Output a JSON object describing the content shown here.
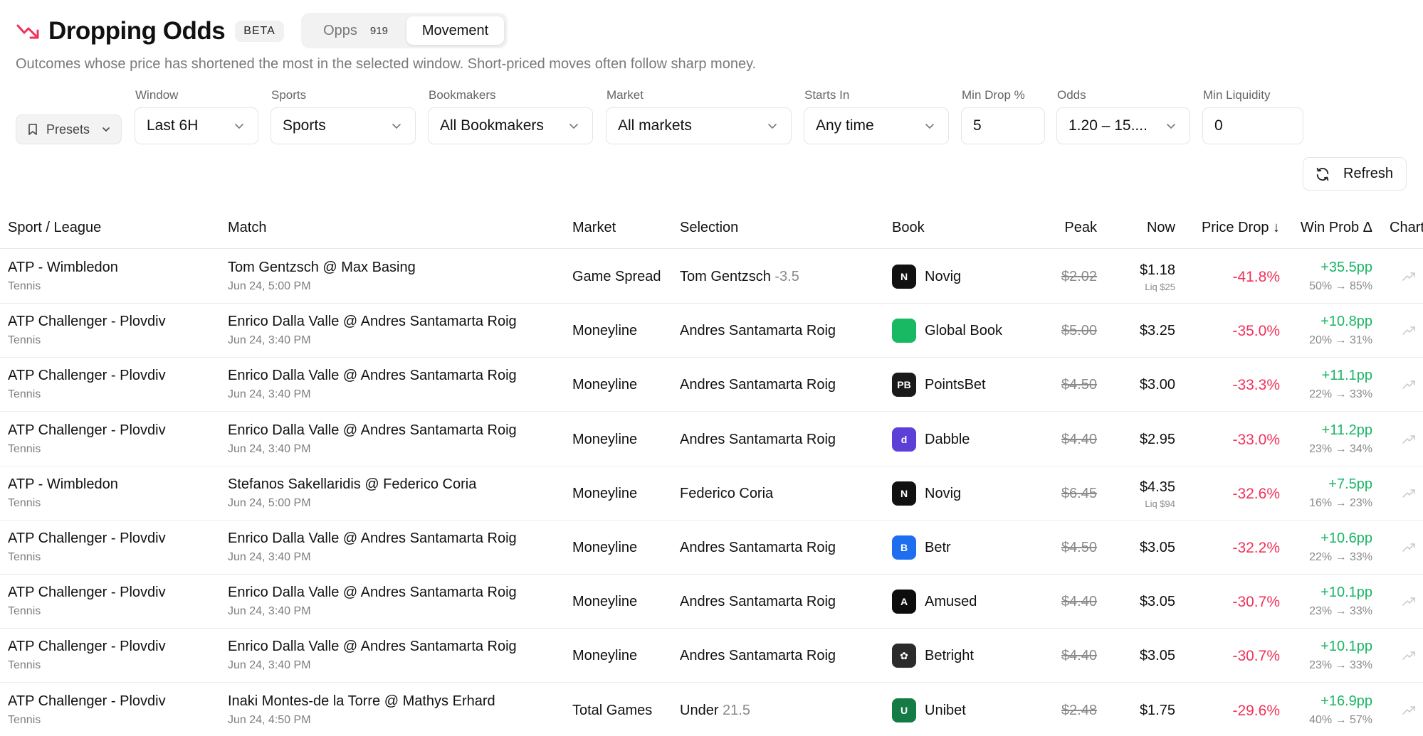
{
  "header": {
    "title": "Dropping Odds",
    "badge": "BETA",
    "subtitle": "Outcomes whose price has shortened the most in the selected window. Short-priced moves often follow sharp money."
  },
  "view_tabs": {
    "opps_label": "Opps",
    "opps_count": "919",
    "movement_label": "Movement",
    "active": "Movement"
  },
  "filters": {
    "presets_label": "Presets",
    "window": {
      "label": "Window",
      "value": "Last 6H"
    },
    "sports": {
      "label": "Sports",
      "value": "Sports"
    },
    "bookmakers": {
      "label": "Bookmakers",
      "value": "All Bookmakers"
    },
    "market": {
      "label": "Market",
      "value": "All markets"
    },
    "starts_in": {
      "label": "Starts In",
      "value": "Any time"
    },
    "min_drop": {
      "label": "Min Drop %",
      "value": "5"
    },
    "odds": {
      "label": "Odds",
      "value": "1.20 – 15...."
    },
    "min_liquidity": {
      "label": "Min Liquidity",
      "value": "0"
    }
  },
  "refresh_label": "Refresh",
  "table": {
    "columns": {
      "sport_league": "Sport / League",
      "match": "Match",
      "market": "Market",
      "selection": "Selection",
      "book": "Book",
      "peak": "Peak",
      "now": "Now",
      "price_drop": "Price Drop ↓",
      "win_prob": "Win Prob Δ",
      "chart": "Chart"
    },
    "rows": [
      {
        "league": "ATP - Wimbledon",
        "sport": "Tennis",
        "match": "Tom Gentzsch @ Max Basing",
        "time": "Jun 24, 5:00 PM",
        "market": "Game Spread",
        "selection": "Tom Gentzsch",
        "selection_line": "-3.5",
        "book": "Novig",
        "book_icon": "novig-logo",
        "book_color": "#111111",
        "peak": "$2.02",
        "now": "$1.18",
        "liq": "Liq $25",
        "drop": "-41.8%",
        "prob": "+35.5pp",
        "prob_range": "50% → 85%"
      },
      {
        "league": "ATP Challenger - Plovdiv",
        "sport": "Tennis",
        "match": "Enrico Dalla Valle @ Andres Santamarta Roig",
        "time": "Jun 24, 3:40 PM",
        "market": "Moneyline",
        "selection": "Andres Santamarta Roig",
        "selection_line": "",
        "book": "Global Book",
        "book_icon": "global-book-logo",
        "book_color": "#19b863",
        "peak": "$5.00",
        "now": "$3.25",
        "liq": "",
        "drop": "-35.0%",
        "prob": "+10.8pp",
        "prob_range": "20% → 31%"
      },
      {
        "league": "ATP Challenger - Plovdiv",
        "sport": "Tennis",
        "match": "Enrico Dalla Valle @ Andres Santamarta Roig",
        "time": "Jun 24, 3:40 PM",
        "market": "Moneyline",
        "selection": "Andres Santamarta Roig",
        "selection_line": "",
        "book": "PointsBet",
        "book_icon": "pointsbet-logo",
        "book_color": "#1a1a1a",
        "peak": "$4.50",
        "now": "$3.00",
        "liq": "",
        "drop": "-33.3%",
        "prob": "+11.1pp",
        "prob_range": "22% → 33%"
      },
      {
        "league": "ATP Challenger - Plovdiv",
        "sport": "Tennis",
        "match": "Enrico Dalla Valle @ Andres Santamarta Roig",
        "time": "Jun 24, 3:40 PM",
        "market": "Moneyline",
        "selection": "Andres Santamarta Roig",
        "selection_line": "",
        "book": "Dabble",
        "book_icon": "dabble-logo",
        "book_color": "#5b3fd6",
        "peak": "$4.40",
        "now": "$2.95",
        "liq": "",
        "drop": "-33.0%",
        "prob": "+11.2pp",
        "prob_range": "23% → 34%"
      },
      {
        "league": "ATP - Wimbledon",
        "sport": "Tennis",
        "match": "Stefanos Sakellaridis @ Federico Coria",
        "time": "Jun 24, 5:00 PM",
        "market": "Moneyline",
        "selection": "Federico Coria",
        "selection_line": "",
        "book": "Novig",
        "book_icon": "novig-logo",
        "book_color": "#111111",
        "peak": "$6.45",
        "now": "$4.35",
        "liq": "Liq $94",
        "drop": "-32.6%",
        "prob": "+7.5pp",
        "prob_range": "16% → 23%"
      },
      {
        "league": "ATP Challenger - Plovdiv",
        "sport": "Tennis",
        "match": "Enrico Dalla Valle @ Andres Santamarta Roig",
        "time": "Jun 24, 3:40 PM",
        "market": "Moneyline",
        "selection": "Andres Santamarta Roig",
        "selection_line": "",
        "book": "Betr",
        "book_icon": "betr-logo",
        "book_color": "#1e6ff0",
        "peak": "$4.50",
        "now": "$3.05",
        "liq": "",
        "drop": "-32.2%",
        "prob": "+10.6pp",
        "prob_range": "22% → 33%"
      },
      {
        "league": "ATP Challenger - Plovdiv",
        "sport": "Tennis",
        "match": "Enrico Dalla Valle @ Andres Santamarta Roig",
        "time": "Jun 24, 3:40 PM",
        "market": "Moneyline",
        "selection": "Andres Santamarta Roig",
        "selection_line": "",
        "book": "Amused",
        "book_icon": "amused-logo",
        "book_color": "#0d0d0d",
        "peak": "$4.40",
        "now": "$3.05",
        "liq": "",
        "drop": "-30.7%",
        "prob": "+10.1pp",
        "prob_range": "23% → 33%"
      },
      {
        "league": "ATP Challenger - Plovdiv",
        "sport": "Tennis",
        "match": "Enrico Dalla Valle @ Andres Santamarta Roig",
        "time": "Jun 24, 3:40 PM",
        "market": "Moneyline",
        "selection": "Andres Santamarta Roig",
        "selection_line": "",
        "book": "Betright",
        "book_icon": "betright-logo",
        "book_color": "#2b2b2b",
        "peak": "$4.40",
        "now": "$3.05",
        "liq": "",
        "drop": "-30.7%",
        "prob": "+10.1pp",
        "prob_range": "23% → 33%"
      },
      {
        "league": "ATP Challenger - Plovdiv",
        "sport": "Tennis",
        "match": "Inaki Montes-de la Torre @ Mathys Erhard",
        "time": "Jun 24, 4:50 PM",
        "market": "Total Games",
        "selection": "Under",
        "selection_line": "21.5",
        "book": "Unibet",
        "book_icon": "unibet-logo",
        "book_color": "#147b45",
        "peak": "$2.48",
        "now": "$1.75",
        "liq": "",
        "drop": "-29.6%",
        "prob": "+16.9pp",
        "prob_range": "40% → 57%"
      }
    ]
  }
}
